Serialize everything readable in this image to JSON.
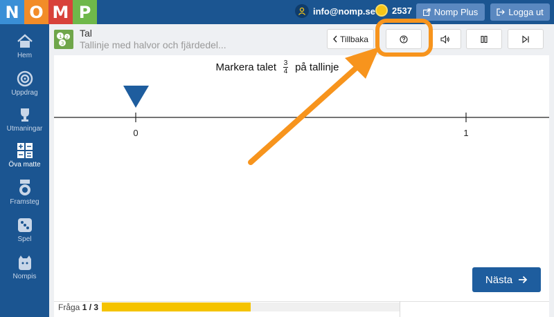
{
  "logo": {
    "letters": [
      "N",
      "O",
      "M",
      "P"
    ],
    "colors": [
      "#3a8fd6",
      "#f28c28",
      "#d8423a",
      "#6fb84a"
    ]
  },
  "topbar": {
    "email": "info@nomp.se",
    "coins": "2537",
    "plus_label": "Nomp Plus",
    "logout_label": "Logga ut"
  },
  "sidebar": {
    "items": [
      {
        "label": "Hem",
        "icon": "home-icon",
        "active": false
      },
      {
        "label": "Uppdrag",
        "icon": "target-icon",
        "active": false
      },
      {
        "label": "Utmaningar",
        "icon": "trophy-icon",
        "active": false
      },
      {
        "label": "Öva matte",
        "icon": "calculator-icon",
        "active": true
      },
      {
        "label": "Framsteg",
        "icon": "medal-icon",
        "active": false
      },
      {
        "label": "Spel",
        "icon": "dice-icon",
        "active": false
      },
      {
        "label": "Nompis",
        "icon": "creature-icon",
        "active": false
      }
    ]
  },
  "header": {
    "title": "Tal",
    "subtitle": "Tallinje med halvor och fjärdedel...",
    "back_label": "Tillbaka"
  },
  "question": {
    "prefix": "Markera talet",
    "numerator": "3",
    "denominator": "4",
    "suffix": "på tallinje"
  },
  "number_line": {
    "labels": [
      "0",
      "1"
    ],
    "marker_value": 0
  },
  "next_label": "Nästa",
  "footer": {
    "question_word": "Fråga",
    "current": "1",
    "total": "3",
    "progress_fraction": 0.5
  },
  "colors": {
    "brand_blue": "#1b5591",
    "accent_orange": "#f7941d",
    "progress_yellow": "#f5c300",
    "marker_blue": "#1e5d9e"
  }
}
